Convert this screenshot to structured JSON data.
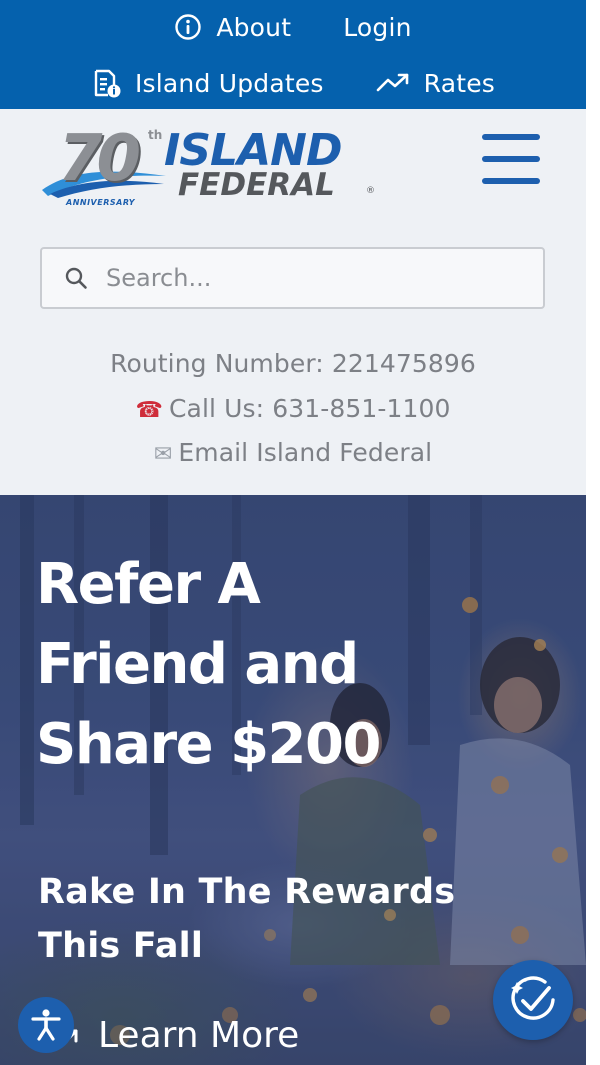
{
  "topbar": {
    "about_label": "About",
    "login_label": "Login",
    "updates_label": "Island Updates",
    "rates_label": "Rates",
    "bg_color": "#0561ad"
  },
  "logo": {
    "seventy": "70",
    "th": "th",
    "anniversary": "ANNIVERSARY",
    "island": "ISLAND",
    "federal": "FEDERAL",
    "reg": "®"
  },
  "search": {
    "placeholder": "Search...",
    "value": ""
  },
  "contact": {
    "routing": "Routing Number: 221475896",
    "call": "Call Us: 631-851-1100",
    "email": "Email Island Federal"
  },
  "hero": {
    "headline": "Refer A Friend and Share $200",
    "subhead": "Rake In The Rewards This Fall",
    "cta": "Learn More"
  },
  "colors": {
    "brand_blue": "#1d5fae",
    "header_bg": "#eef1f5",
    "phone_red": "#cf2d3a"
  }
}
